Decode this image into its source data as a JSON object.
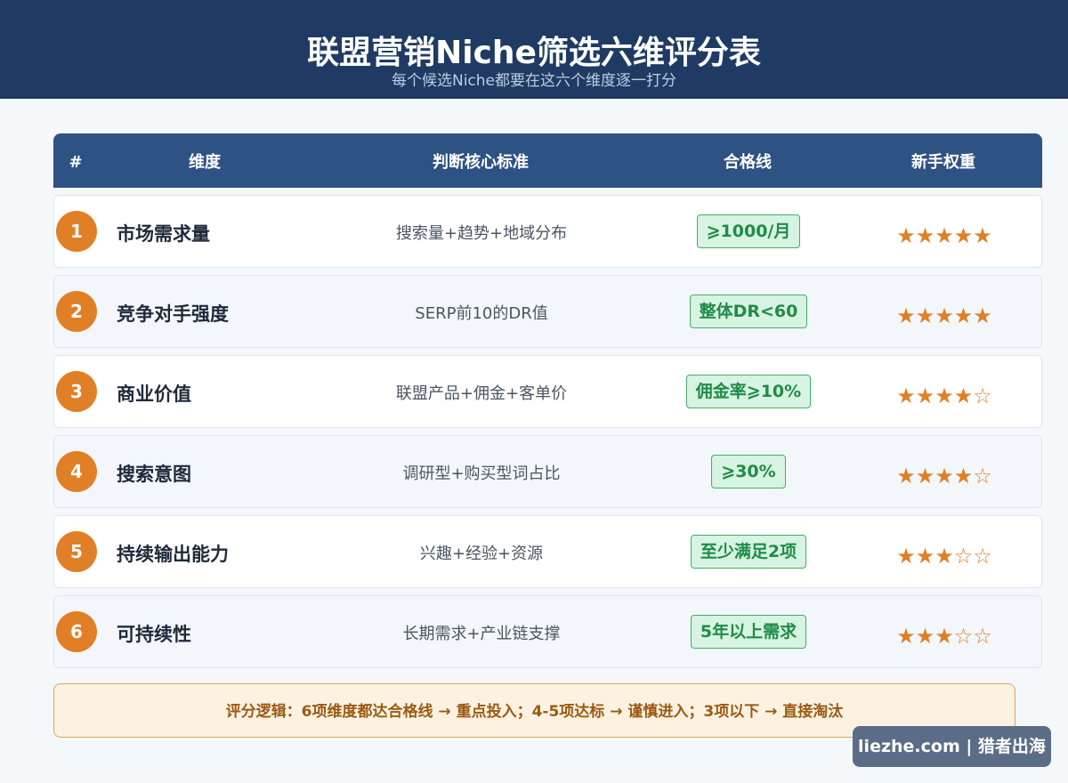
{
  "header": {
    "title": "联盟营销Niche筛选六维评分表",
    "subtitle": "每个候选Niche都要在这六个维度逐一打分"
  },
  "table": {
    "columns": [
      "#",
      "维度",
      "判断核心标准",
      "合格线",
      "新手权重"
    ],
    "rows": [
      {
        "num": "1",
        "dimension": "市场需求量",
        "criteria": "搜索量+趋势+地域分布",
        "pass_line": "⩾1000/月",
        "weight": "★★★★★",
        "weight_value": 5
      },
      {
        "num": "2",
        "dimension": "竞争对手强度",
        "criteria": "SERP前10的DR值",
        "pass_line": "整体DR<60",
        "weight": "★★★★★",
        "weight_value": 5
      },
      {
        "num": "3",
        "dimension": "商业价值",
        "criteria": "联盟产品+佣金+客单价",
        "pass_line": "佣金率⩾10%",
        "weight": "★★★★☆",
        "weight_value": 4
      },
      {
        "num": "4",
        "dimension": "搜索意图",
        "criteria": "调研型+购买型词占比",
        "pass_line": "⩾30%",
        "weight": "★★★★☆",
        "weight_value": 4
      },
      {
        "num": "5",
        "dimension": "持续输出能力",
        "criteria": "兴趣+经验+资源",
        "pass_line": "至少满足2项",
        "weight": "★★★☆☆",
        "weight_value": 3
      },
      {
        "num": "6",
        "dimension": "可持续性",
        "criteria": "长期需求+产业链支撑",
        "pass_line": "5年以上需求",
        "weight": "★★★☆☆",
        "weight_value": 3
      }
    ]
  },
  "logic_note": "评分逻辑：6项维度都达合格线 → 重点投入；4-5项达标 → 谨慎进入；3项以下 → 直接淘汰",
  "watermark": "liezhe.com | 猎者出海",
  "colors": {
    "header_bg": "#1f3b63",
    "table_head_bg": "#2d5283",
    "badge_orange": "#e07f26",
    "pass_green": "#1f8c48",
    "logic_bg": "#fdf2e2"
  }
}
